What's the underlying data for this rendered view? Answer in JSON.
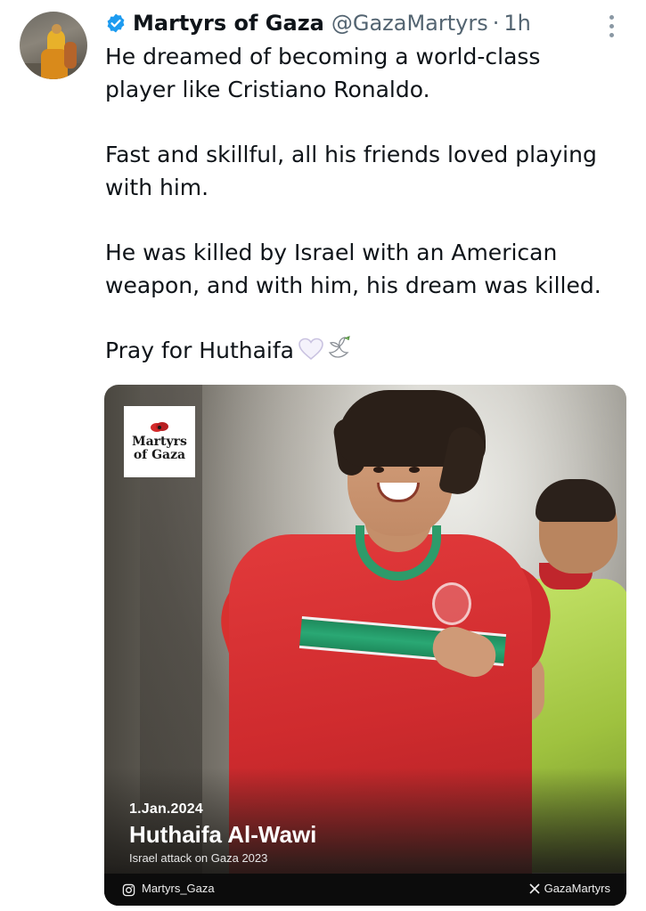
{
  "author": {
    "name": "Martyrs of Gaza",
    "handle": "@GazaMartyrs",
    "separator": "·",
    "time": "1h",
    "verified_color": "#1d9bf0"
  },
  "tweet": {
    "p1_line1": "He dreamed of becoming a world-class",
    "p1_line2": "player like Cristiano Ronaldo.",
    "p2_line1": "Fast and skillful, all his friends loved playing",
    "p2_line2": "with him.",
    "p3_line1": "He was killed by Israel with an American",
    "p3_line2": "weapon, and with him, his dream was killed.",
    "p4": "Pray for Huthaifa",
    "emojis": [
      "white-heart-icon",
      "dove-icon"
    ]
  },
  "media": {
    "watermark_line1": "Martyrs",
    "watermark_line2": "of Gaza",
    "date": "1.Jan.2024",
    "person_name": "Huthaifa Al-Wawi",
    "subtitle": "Israel attack on Gaza 2023",
    "instagram_handle": "Martyrs_Gaza",
    "x_handle": "GazaMartyrs"
  }
}
